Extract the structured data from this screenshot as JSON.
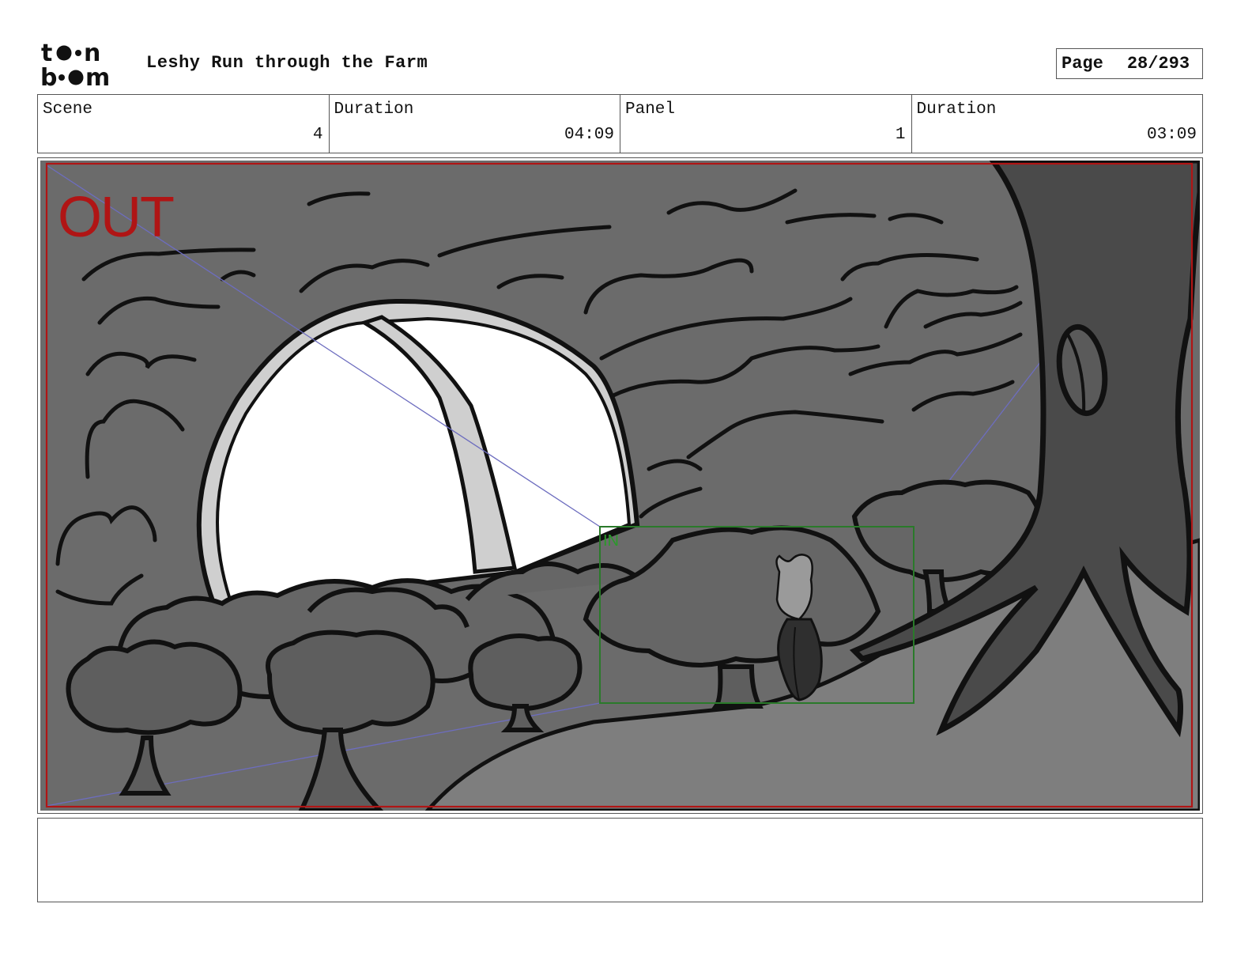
{
  "header": {
    "logo": {
      "line1": "toon",
      "line2": "boom",
      "icon": "toonboom-logo"
    },
    "title": "Leshy Run through the Farm",
    "page_label": "Page",
    "page_number": "28/293"
  },
  "info": {
    "scene_label": "Scene",
    "scene_value": "4",
    "scene_duration_label": "Duration",
    "scene_duration_value": "04:09",
    "panel_label": "Panel",
    "panel_value": "1",
    "panel_duration_label": "Duration",
    "panel_duration_value": "03:09"
  },
  "panel": {
    "out_marker": "OUT",
    "in_marker": "IN",
    "colors": {
      "out_frame": "#b01515",
      "in_frame": "#2a7a2a",
      "guide_lines": "#6d6dbf"
    },
    "description_icons": [
      "moon-icon",
      "tree-icon",
      "bush-icon",
      "character-icon"
    ]
  },
  "notes": {
    "text": ""
  }
}
